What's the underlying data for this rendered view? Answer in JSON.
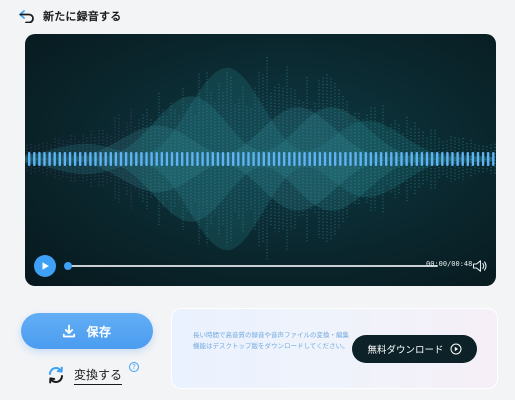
{
  "header": {
    "back_icon": "back-arrow-icon",
    "title": "新たに録音する"
  },
  "player": {
    "time": "00:00/00:48",
    "progress_percent": 0,
    "play_icon": "play-icon",
    "volume_icon": "speaker-icon",
    "accent_color": "#3ea1f5"
  },
  "actions": {
    "save_label": "保存",
    "save_icon": "download-icon",
    "convert_label": "変換する",
    "convert_icon": "refresh-arrows-icon",
    "help_symbol": "?"
  },
  "promo": {
    "text": "長い時間で高音質の録音や音声ファイルの変換・編集機能はデスクトップ版をダウンロードしてください。",
    "button_label": "無料ダウンロード",
    "button_icon": "play-circle-icon"
  }
}
